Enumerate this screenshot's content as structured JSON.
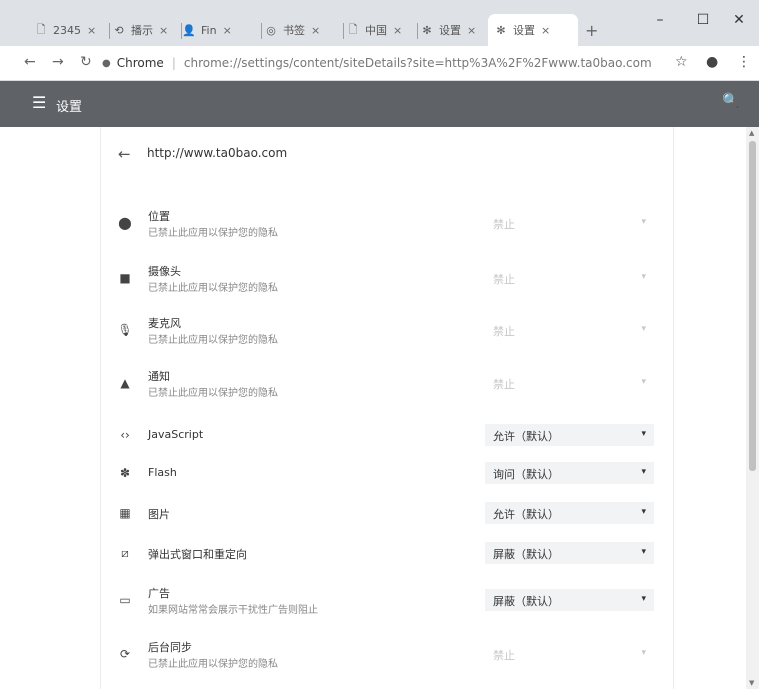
{
  "browser": {
    "tabs": [
      {
        "title": "2345",
        "icon": "page-icon",
        "glyph": "🗋",
        "active": false
      },
      {
        "title": "播示",
        "icon": "history-icon",
        "glyph": "⟲",
        "active": false
      },
      {
        "title": "Fin",
        "icon": "person-icon",
        "glyph": "👤",
        "active": false
      },
      {
        "title": "书签",
        "icon": "chrome-icon",
        "glyph": "◎",
        "active": false
      },
      {
        "title": "中国",
        "icon": "page-icon",
        "glyph": "🗋",
        "active": false
      },
      {
        "title": "设置",
        "icon": "gear-icon",
        "glyph": "✻",
        "active": false
      },
      {
        "title": "设置",
        "icon": "gear-icon",
        "glyph": "✻",
        "active": true
      }
    ],
    "tab_close": "×",
    "new_tab": "+",
    "window_controls": {
      "minimize": "–",
      "maximize": "☐",
      "close": "✕"
    },
    "nav": {
      "back": "←",
      "forward": "→",
      "reload": "↻"
    },
    "omnibox": {
      "secure_icon": "●",
      "origin": "Chrome",
      "url": "chrome://settings/content/siteDetails?site=http%3A%2F%2Fwww.ta0bao.com"
    },
    "toolbar_icons": {
      "star": "☆",
      "profile": "●",
      "menu": "⋮"
    }
  },
  "appbar": {
    "menu_glyph": "☰",
    "title": "设置",
    "search_glyph": "🔍"
  },
  "page": {
    "back_glyph": "←",
    "site_url": "http://www.ta0bao.com"
  },
  "permissions": [
    {
      "icon": "location-icon",
      "glyph": "⬤",
      "name": "位置",
      "desc": "已禁止此应用以保护您的隐私",
      "value": "禁止",
      "disabled": true
    },
    {
      "icon": "camera-icon",
      "glyph": "■",
      "name": "摄像头",
      "desc": "已禁止此应用以保护您的隐私",
      "value": "禁止",
      "disabled": true
    },
    {
      "icon": "microphone-icon",
      "glyph": "🎙",
      "name": "麦克风",
      "desc": "已禁止此应用以保护您的隐私",
      "value": "禁止",
      "disabled": true
    },
    {
      "icon": "bell-icon",
      "glyph": "▲",
      "name": "通知",
      "desc": "已禁止此应用以保护您的隐私",
      "value": "禁止",
      "disabled": true
    },
    {
      "icon": "code-icon",
      "glyph": "‹›",
      "name": "JavaScript",
      "desc": "",
      "value": "允许（默认）",
      "disabled": false
    },
    {
      "icon": "puzzle-icon",
      "glyph": "✽",
      "name": "Flash",
      "desc": "",
      "value": "询问（默认）",
      "disabled": false
    },
    {
      "icon": "image-icon",
      "glyph": "▦",
      "name": "图片",
      "desc": "",
      "value": "允许（默认）",
      "disabled": false
    },
    {
      "icon": "popup-icon",
      "glyph": "⧄",
      "name": "弹出式窗口和重定向",
      "desc": "",
      "value": "屏蔽（默认）",
      "disabled": false
    },
    {
      "icon": "ads-icon",
      "glyph": "▭",
      "name": "广告",
      "desc": "如果网站常常会展示干扰性广告则阻止",
      "value": "屏蔽（默认）",
      "disabled": false
    },
    {
      "icon": "sync-icon",
      "glyph": "⟳",
      "name": "后台同步",
      "desc": "已禁止此应用以保护您的隐私",
      "value": "禁止",
      "disabled": true
    }
  ],
  "caret": "▾",
  "scrollbar": {
    "up": "▲",
    "down": "▼"
  }
}
